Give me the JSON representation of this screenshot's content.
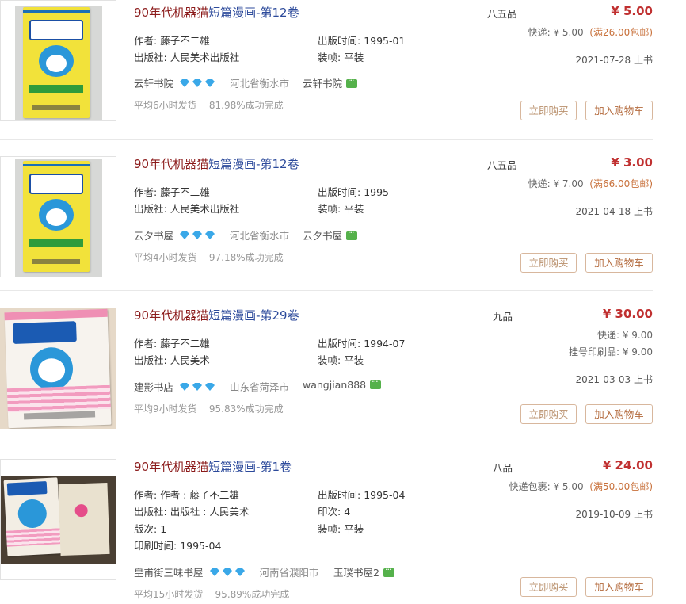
{
  "colors": {
    "title": "#8b1a1a",
    "title_highlight": "#2c4a9b",
    "price": "#c03030",
    "free_shipping": "#c8703a",
    "diamond": "#3aa8e8",
    "chat_icon": "#55b14b",
    "button_border": "#d8b79d"
  },
  "listings": [
    {
      "title_main": "90年代机器猫",
      "title_highlight": "短篇漫画-第12卷",
      "fields": [
        {
          "label": "作者:",
          "value": "藤子不二雄"
        },
        {
          "label": "出版时间:",
          "value": "1995-01"
        },
        {
          "label": "出版社:",
          "value": "人民美术出版社"
        },
        {
          "label": "装帧:",
          "value": "平装"
        }
      ],
      "shop_name": "云轩书院",
      "location": "河北省衡水市",
      "seller": "云轩书院",
      "stat_hours": "平均6小时发货",
      "stat_rate": "81.98%成功完成",
      "condition": "八五品",
      "price": "¥ 5.00",
      "shipping_lines": [
        {
          "text": "快递: ¥ 5.00",
          "free": "(满26.00包邮)"
        }
      ],
      "date": "2021-07-28 上书",
      "buy_label": "立即购买",
      "cart_label": "加入购物车",
      "icons": [
        "diamond-icon",
        "chat-icon"
      ]
    },
    {
      "title_main": "90年代机器猫",
      "title_highlight": "短篇漫画-第12卷",
      "fields": [
        {
          "label": "作者:",
          "value": "藤子不二雄"
        },
        {
          "label": "出版时间:",
          "value": "1995"
        },
        {
          "label": "出版社:",
          "value": "人民美术出版社"
        },
        {
          "label": "装帧:",
          "value": "平装"
        }
      ],
      "shop_name": "云夕书屋",
      "location": "河北省衡水市",
      "seller": "云夕书屋",
      "stat_hours": "平均4小时发货",
      "stat_rate": "97.18%成功完成",
      "condition": "八五品",
      "price": "¥ 3.00",
      "shipping_lines": [
        {
          "text": "快递: ¥ 7.00",
          "free": "(满66.00包邮)"
        }
      ],
      "date": "2021-04-18 上书",
      "buy_label": "立即购买",
      "cart_label": "加入购物车"
    },
    {
      "title_main": "90年代机器猫",
      "title_highlight": "短篇漫画-第29卷",
      "fields": [
        {
          "label": "作者:",
          "value": "藤子不二雄"
        },
        {
          "label": "出版时间:",
          "value": "1994-07"
        },
        {
          "label": "出版社:",
          "value": "人民美术"
        },
        {
          "label": "装帧:",
          "value": "平装"
        }
      ],
      "shop_name": "建影书店",
      "location": "山东省菏泽市",
      "seller": "wangjian888",
      "stat_hours": "平均9小时发货",
      "stat_rate": "95.83%成功完成",
      "condition": "九品",
      "price": "¥ 30.00",
      "shipping_lines": [
        {
          "text": "快递: ¥ 9.00",
          "free": ""
        },
        {
          "text": "挂号印刷品: ¥ 9.00",
          "free": ""
        }
      ],
      "date": "2021-03-03 上书",
      "buy_label": "立即购买",
      "cart_label": "加入购物车"
    },
    {
      "title_main": "90年代机器猫",
      "title_highlight": "短篇漫画-第1卷",
      "fields": [
        {
          "label": "作者:",
          "value": "作者 : 藤子不二雄"
        },
        {
          "label": "出版时间:",
          "value": "1995-04"
        },
        {
          "label": "出版社:",
          "value": "出版社 : 人民美术"
        },
        {
          "label": "印次:",
          "value": "4"
        },
        {
          "label": "版次:",
          "value": "1"
        },
        {
          "label": "装帧:",
          "value": "平装"
        },
        {
          "label": "印刷时间:",
          "value": "1995-04"
        }
      ],
      "shop_name": "皇甫街三味书屋",
      "location": "河南省濮阳市",
      "seller": "玉璞书屋2",
      "stat_hours": "平均15小时发货",
      "stat_rate": "95.89%成功完成",
      "condition": "八品",
      "price": "¥ 24.00",
      "shipping_lines": [
        {
          "text": "快递包裹: ¥ 5.00",
          "free": "(满50.00包邮)"
        }
      ],
      "date": "2019-10-09 上书",
      "buy_label": "立即购买",
      "cart_label": "加入购物车"
    }
  ]
}
